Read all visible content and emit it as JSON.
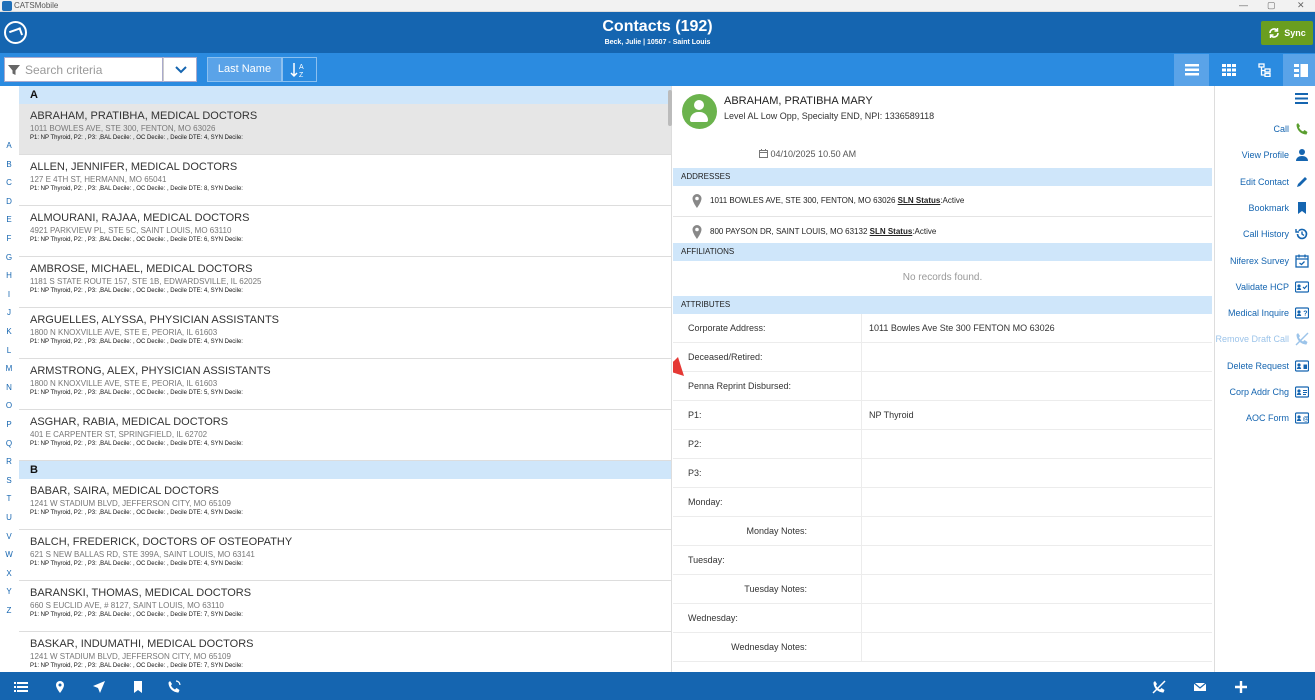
{
  "window": {
    "app_name": "CATSMobile"
  },
  "header": {
    "title": "Contacts (192)",
    "subtitle": "Beck, Julie | 10507 - Saint Louis",
    "sync_label": "Sync"
  },
  "toolbar": {
    "search_placeholder": "Search criteria",
    "sort_field": "Last Name"
  },
  "alphabet": [
    "A",
    "B",
    "C",
    "D",
    "E",
    "F",
    "G",
    "H",
    "I",
    "J",
    "K",
    "L",
    "M",
    "N",
    "O",
    "P",
    "Q",
    "R",
    "S",
    "T",
    "U",
    "V",
    "W",
    "X",
    "Y",
    "Z"
  ],
  "list": {
    "sections": [
      {
        "letter": "A",
        "contacts": [
          {
            "name": "ABRAHAM, PRATIBHA, MEDICAL DOCTORS",
            "address": "1011 BOWLES AVE, STE 300, FENTON, MO 63026",
            "meta": "P1: NP Thyroid, P2: , P3: ,BAL Decile: , OC Decile: , Decile DTE: 4, SYN Decile:",
            "selected": true
          },
          {
            "name": "ALLEN, JENNIFER, MEDICAL DOCTORS",
            "address": "127 E 4TH ST, HERMANN, MO 65041",
            "meta": "P1: NP Thyroid, P2: , P3: ,BAL Decile: , OC Decile: , Decile DTE: 8, SYN Decile:",
            "selected": false
          },
          {
            "name": "ALMOURANI, RAJAA, MEDICAL DOCTORS",
            "address": "4921 PARKVIEW PL, STE 5C, SAINT LOUIS, MO 63110",
            "meta": "P1: NP Thyroid, P2: , P3: ,BAL Decile: , OC Decile: , Decile DTE: 6, SYN Decile:",
            "selected": false
          },
          {
            "name": "AMBROSE, MICHAEL, MEDICAL DOCTORS",
            "address": "1181 S STATE ROUTE 157, STE 1B, EDWARDSVILLE, IL 62025",
            "meta": "P1: NP Thyroid, P2: , P3: ,BAL Decile: , OC Decile: , Decile DTE: 4, SYN Decile:",
            "selected": false
          },
          {
            "name": "ARGUELLES, ALYSSA, PHYSICIAN ASSISTANTS",
            "address": "1800 N KNOXVILLE AVE, STE E, PEORIA, IL 61603",
            "meta": "P1: NP Thyroid, P2: , P3: ,BAL Decile: , OC Decile: , Decile DTE: 4, SYN Decile:",
            "selected": false
          },
          {
            "name": "ARMSTRONG, ALEX, PHYSICIAN ASSISTANTS",
            "address": "1800 N KNOXVILLE AVE, STE E, PEORIA, IL 61603",
            "meta": "P1: NP Thyroid, P2: , P3: ,BAL Decile: , OC Decile: , Decile DTE: 5, SYN Decile:",
            "selected": false
          },
          {
            "name": "ASGHAR, RABIA, MEDICAL DOCTORS",
            "address": "401 E CARPENTER ST, SPRINGFIELD, IL 62702",
            "meta": "P1: NP Thyroid, P2: , P3: ,BAL Decile: , OC Decile: , Decile DTE: 4, SYN Decile:",
            "selected": false
          }
        ]
      },
      {
        "letter": "B",
        "contacts": [
          {
            "name": "BABAR, SAIRA, MEDICAL DOCTORS",
            "address": "1241 W STADIUM BLVD, JEFFERSON CITY, MO 65109",
            "meta": "P1: NP Thyroid, P2: , P3: ,BAL Decile: , OC Decile: , Decile DTE: 4, SYN Decile:",
            "selected": false
          },
          {
            "name": "BALCH, FREDERICK, DOCTORS OF OSTEOPATHY",
            "address": "621 S NEW BALLAS RD, STE 399A, SAINT LOUIS, MO 63141",
            "meta": "P1: NP Thyroid, P2: , P3: ,BAL Decile: , OC Decile: , Decile DTE: 4, SYN Decile:",
            "selected": false
          },
          {
            "name": "BARANSKI, THOMAS, MEDICAL DOCTORS",
            "address": "660 S EUCLID AVE, # 8127, SAINT LOUIS, MO 63110",
            "meta": "P1: NP Thyroid, P2: , P3: ,BAL Decile: , OC Decile: , Decile DTE: 7, SYN Decile:",
            "selected": false
          },
          {
            "name": "BASKAR, INDUMATHI, MEDICAL DOCTORS",
            "address": "1241 W STADIUM BLVD, JEFFERSON CITY, MO 65109",
            "meta": "P1: NP Thyroid, P2: , P3: ,BAL Decile: , OC Decile: , Decile DTE: 7, SYN Decile:",
            "selected": false
          }
        ]
      }
    ]
  },
  "detail": {
    "name": "ABRAHAM, PRATIBHA MARY",
    "subtitle": "Level AL Low Opp, Specialty END, NPI: 1336589118",
    "date": "04/10/2025 10.50 AM",
    "addresses_label": "ADDRESSES",
    "addresses": [
      {
        "text": "1011 BOWLES AVE, STE 300, FENTON, MO 63026 ",
        "status_label": "SLN Status",
        "status": ":Active"
      },
      {
        "text": "800 PAYSON DR, SAINT LOUIS, MO 63132 ",
        "status_label": "SLN Status",
        "status": ":Active"
      }
    ],
    "affiliations_label": "AFFILIATIONS",
    "no_records": "No records found.",
    "attributes_label": "ATTRIBUTES",
    "attributes": [
      {
        "label": "Corporate Address:",
        "value": "1011 Bowles Ave Ste 300 FENTON MO 63026",
        "indent": false
      },
      {
        "label": "Deceased/Retired:",
        "value": "",
        "indent": false
      },
      {
        "label": "Penna Reprint Disbursed:",
        "value": "",
        "indent": false
      },
      {
        "label": "P1:",
        "value": "NP Thyroid",
        "indent": false
      },
      {
        "label": "P2:",
        "value": "",
        "indent": false
      },
      {
        "label": "P3:",
        "value": "",
        "indent": false
      },
      {
        "label": "Monday:",
        "value": "",
        "indent": false
      },
      {
        "label": "Monday Notes:",
        "value": "",
        "indent": true
      },
      {
        "label": "Tuesday:",
        "value": "",
        "indent": false
      },
      {
        "label": "Tuesday Notes:",
        "value": "",
        "indent": true
      },
      {
        "label": "Wednesday:",
        "value": "",
        "indent": false
      },
      {
        "label": "Wednesday Notes:",
        "value": "",
        "indent": true
      }
    ]
  },
  "actions": [
    {
      "label": "Call",
      "icon": "phone-icon",
      "color": "#5a9e2f",
      "disabled": false
    },
    {
      "label": "View Profile",
      "icon": "person-icon",
      "color": "#1565b0",
      "disabled": false
    },
    {
      "label": "Edit Contact",
      "icon": "pencil-icon",
      "color": "#1565b0",
      "disabled": false
    },
    {
      "label": "Bookmark",
      "icon": "bookmark-icon",
      "color": "#1565b0",
      "disabled": false
    },
    {
      "label": "Call History",
      "icon": "history-icon",
      "color": "#1565b0",
      "disabled": false
    },
    {
      "label": "Niferex Survey",
      "icon": "calendar-check-icon",
      "color": "#1565b0",
      "disabled": false
    },
    {
      "label": "Validate HCP",
      "icon": "id-card-check-icon",
      "color": "#1565b0",
      "disabled": false
    },
    {
      "label": "Medical Inquire",
      "icon": "id-card-question-icon",
      "color": "#1565b0",
      "disabled": false
    },
    {
      "label": "Remove Draft Call",
      "icon": "phone-slash-icon",
      "color": "#9cc4ea",
      "disabled": true
    },
    {
      "label": "Delete Request",
      "icon": "id-card-trash-icon",
      "color": "#1565b0",
      "disabled": false
    },
    {
      "label": "Corp Addr Chg",
      "icon": "id-card-lines-icon",
      "color": "#1565b0",
      "disabled": false
    },
    {
      "label": "AOC Form",
      "icon": "id-card-at-icon",
      "color": "#1565b0",
      "disabled": false
    }
  ],
  "colors": {
    "header": "#1565b0",
    "toolbar": "#2b8be0",
    "section": "#cfe6fa",
    "sync": "#6a9e1f",
    "arrow": "#e53935"
  }
}
